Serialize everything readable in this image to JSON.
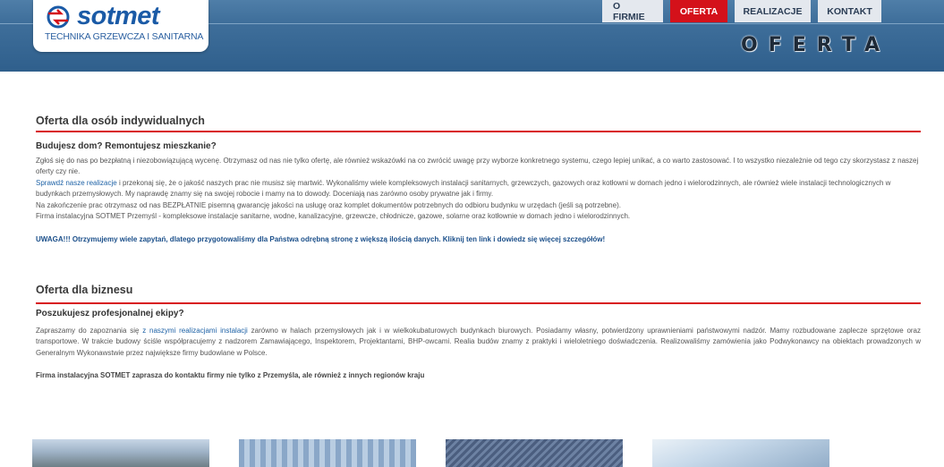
{
  "brand": {
    "name": "sotmet",
    "tagline": "TECHNIKA GRZEWCZA I SANITARNA"
  },
  "nav": {
    "items": [
      {
        "label": "O FIRMIE",
        "active": false
      },
      {
        "label": "OFERTA",
        "active": true
      },
      {
        "label": "REALIZACJE",
        "active": false
      },
      {
        "label": "KONTAKT",
        "active": false
      }
    ]
  },
  "page_heading": "OFERTA",
  "individual": {
    "title": "Oferta dla osób indywidualnych",
    "subtitle": "Budujesz dom? Remontujesz mieszkanie?",
    "p1": "Zgłoś się do nas po bezpłatną i niezobowiązującą wycenę. Otrzymasz od nas nie tylko ofertę, ale również wskazówki na co zwrócić uwagę przy wyborze konkretnego systemu, czego lepiej unikać, a co warto zastosować. I to wszystko niezależnie od tego czy skorzystasz z naszej oferty czy nie.",
    "p2_link": "Sprawdź nasze realizacje",
    "p2_rest": " i przekonaj się, że o jakość naszych prac nie musisz się martwić. Wykonaliśmy wiele kompleksowych instalacji sanitarnych, grzewczych, gazowych oraz kotłowni w domach jedno i wielorodzinnych, ale również wiele instalacji technologicznych w budynkach przemysłowych. My naprawdę znamy się na swojej robocie i mamy na to dowody. Doceniają nas zarówno osoby prywatne jak i firmy.",
    "p3": "Na zakończenie prac otrzymasz od nas BEZPŁATNIE pisemną gwarancję jakości na usługę oraz komplet dokumentów potrzebnych do odbioru budynku w urzędach (jeśli są potrzebne).",
    "p4": "Firma instalacyjna SOTMET Przemyśl - kompleksowe instalacje sanitarne, wodne, kanalizacyjne, grzewcze, chłodnicze, gazowe, solarne oraz kotłownie w domach jedno i wielorodzinnych.",
    "notice": "UWAGA!!! Otrzymujemy wiele zapytań, dlatego przygotowaliśmy dla Państwa odrębną stronę z większą ilością danych. Kliknij ten link i dowiedz się więcej szczegółów!"
  },
  "business": {
    "title": "Oferta dla biznesu",
    "subtitle": "Poszukujesz profesjonalnej ekipy?",
    "p1_start": "Zapraszamy do zapoznania się ",
    "p1_link": "z naszymi realizacjami instalacji",
    "p1_rest": " zarówno w halach przemysłowych jak i w wielkokubaturowych budynkach biurowych. Posiadamy własny, potwierdzony uprawnieniami państwowymi nadzór. Mamy rozbudowane zaplecze sprzętowe oraz transportowe. W trakcie budowy ściśle współpracujemy z nadzorem Zamawiającego, Inspektorem, Projektantami, BHP-owcami. Realia budów znamy z praktyki i wieloletniego doświadczenia. Realizowaliśmy zamówienia jako Podwykonawcy na obiektach prowadzonych w Generalnym Wykonawstwie przez największe firmy budowlane w Polsce.",
    "note": "Firma instalacyjna SOTMET zaprasza do kontaktu firmy nie tylko z Przemyśla, ale również z innych regionów kraju"
  }
}
